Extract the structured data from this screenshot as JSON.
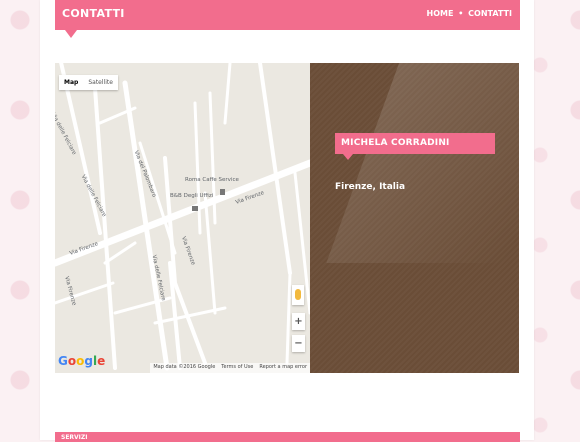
{
  "header": {
    "title": "CONTATTI",
    "breadcrumb": {
      "home": "HOME",
      "separator": "•",
      "current": "CONTATTI"
    }
  },
  "map": {
    "type_controls": {
      "map": "Map",
      "satellite": "Satellite",
      "selected": "Map"
    },
    "labels": {
      "roma_caffe": "Roma Caffe Service",
      "bb_uffizi": "B&B Degli Uffizi",
      "via_firenze_1": "Via Firenze",
      "via_firenze_2": "Via Firenze",
      "via_firenze_3": "Via Firenze",
      "via_firenze_4": "Via Firenze",
      "via_delle_felciare_1": "Via delle Felciare",
      "via_delle_felciare_2": "Via delle Felciare",
      "via_delle_felciare_3": "Via delle Felciare",
      "via_del_palombaro": "Via del Palombaro"
    },
    "zoom_in": "+",
    "zoom_out": "−",
    "google_logo": "Google",
    "footer": {
      "map_data": "Map data ©2016 Google",
      "terms": "Terms of Use",
      "report": "Report a map error"
    }
  },
  "contact": {
    "name": "MICHELA CORRADINI",
    "location": "Firenze, Italia"
  },
  "next_section": {
    "title": "SERVIZI"
  },
  "colors": {
    "accent": "#f26d8d",
    "panel": "#6a4d37",
    "map_bg": "#ebe8e1"
  }
}
